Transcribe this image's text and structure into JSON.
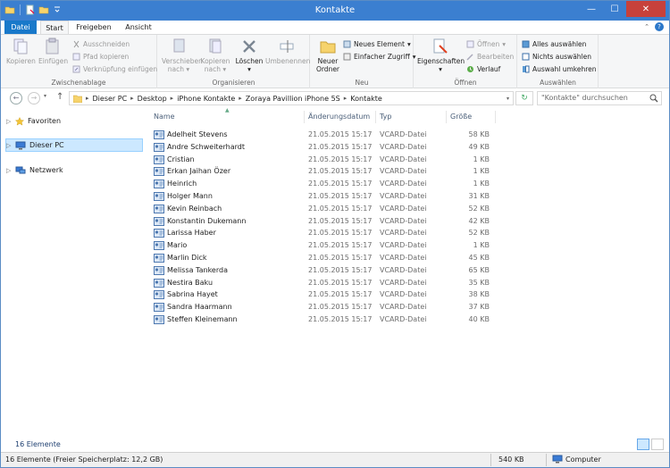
{
  "window": {
    "title": "Kontakte"
  },
  "tabs": {
    "file": "Datei",
    "start": "Start",
    "share": "Freigeben",
    "view": "Ansicht"
  },
  "ribbon": {
    "clipboard": {
      "group_label": "Zwischenablage",
      "copy": "Kopieren",
      "paste": "Einfügen",
      "cut": "Ausschneiden",
      "copy_path": "Pfad kopieren",
      "paste_shortcut": "Verknüpfung einfügen"
    },
    "organize": {
      "group_label": "Organisieren",
      "move_to": [
        "Verschieben",
        "nach"
      ],
      "copy_to": [
        "Kopieren",
        "nach"
      ],
      "delete": "Löschen",
      "rename": "Umbenennen"
    },
    "new": {
      "group_label": "Neu",
      "new_folder": [
        "Neuer",
        "Ordner"
      ],
      "new_item": "Neues Element",
      "easy_access": "Einfacher Zugriff"
    },
    "open": {
      "group_label": "Öffnen",
      "properties": "Eigenschaften",
      "open": "Öffnen",
      "edit": "Bearbeiten",
      "history": "Verlauf"
    },
    "select": {
      "group_label": "Auswählen",
      "select_all": "Alles auswählen",
      "select_none": "Nichts auswählen",
      "invert": "Auswahl umkehren"
    }
  },
  "address": {
    "crumbs": [
      "Dieser PC",
      "Desktop",
      "iPhone Kontakte",
      "Zoraya Pavillion iPhone 5S",
      "Kontakte"
    ],
    "search_placeholder": "\"Kontakte\" durchsuchen"
  },
  "navpane": {
    "favorites": "Favoriten",
    "this_pc": "Dieser PC",
    "network": "Netzwerk"
  },
  "columns": {
    "name": "Name",
    "date": "Änderungsdatum",
    "type": "Typ",
    "size": "Größe"
  },
  "files": [
    {
      "name": "Adelheit Stevens",
      "date": "21.05.2015 15:17",
      "type": "VCARD-Datei",
      "size": "58 KB"
    },
    {
      "name": "Andre Schweiterhardt",
      "date": "21.05.2015 15:17",
      "type": "VCARD-Datei",
      "size": "49 KB"
    },
    {
      "name": "Cristian",
      "date": "21.05.2015 15:17",
      "type": "VCARD-Datei",
      "size": "1 KB"
    },
    {
      "name": "Erkan Jaihan Özer",
      "date": "21.05.2015 15:17",
      "type": "VCARD-Datei",
      "size": "1 KB"
    },
    {
      "name": "Heinrich",
      "date": "21.05.2015 15:17",
      "type": "VCARD-Datei",
      "size": "1 KB"
    },
    {
      "name": "Holger Mann",
      "date": "21.05.2015 15:17",
      "type": "VCARD-Datei",
      "size": "31 KB"
    },
    {
      "name": "Kevin Reinbach",
      "date": "21.05.2015 15:17",
      "type": "VCARD-Datei",
      "size": "52 KB"
    },
    {
      "name": "Konstantin Dukemann",
      "date": "21.05.2015 15:17",
      "type": "VCARD-Datei",
      "size": "42 KB"
    },
    {
      "name": "Larissa Haber",
      "date": "21.05.2015 15:17",
      "type": "VCARD-Datei",
      "size": "52 KB"
    },
    {
      "name": "Mario",
      "date": "21.05.2015 15:17",
      "type": "VCARD-Datei",
      "size": "1 KB"
    },
    {
      "name": "Marlin Dick",
      "date": "21.05.2015 15:17",
      "type": "VCARD-Datei",
      "size": "45 KB"
    },
    {
      "name": "Melissa Tankerda",
      "date": "21.05.2015 15:17",
      "type": "VCARD-Datei",
      "size": "65 KB"
    },
    {
      "name": "Nestira Baku",
      "date": "21.05.2015 15:17",
      "type": "VCARD-Datei",
      "size": "35 KB"
    },
    {
      "name": "Sabrina Hayet",
      "date": "21.05.2015 15:17",
      "type": "VCARD-Datei",
      "size": "38 KB"
    },
    {
      "name": "Sandra Haarmann",
      "date": "21.05.2015 15:17",
      "type": "VCARD-Datei",
      "size": "37 KB"
    },
    {
      "name": "Steffen Kleinemann",
      "date": "21.05.2015 15:17",
      "type": "VCARD-Datei",
      "size": "40 KB"
    }
  ],
  "status": {
    "item_count": "16 Elemente",
    "free_space": "16 Elemente (Freier Speicherplatz: 12,2 GB)",
    "total_size": "540 KB",
    "location": "Computer"
  }
}
